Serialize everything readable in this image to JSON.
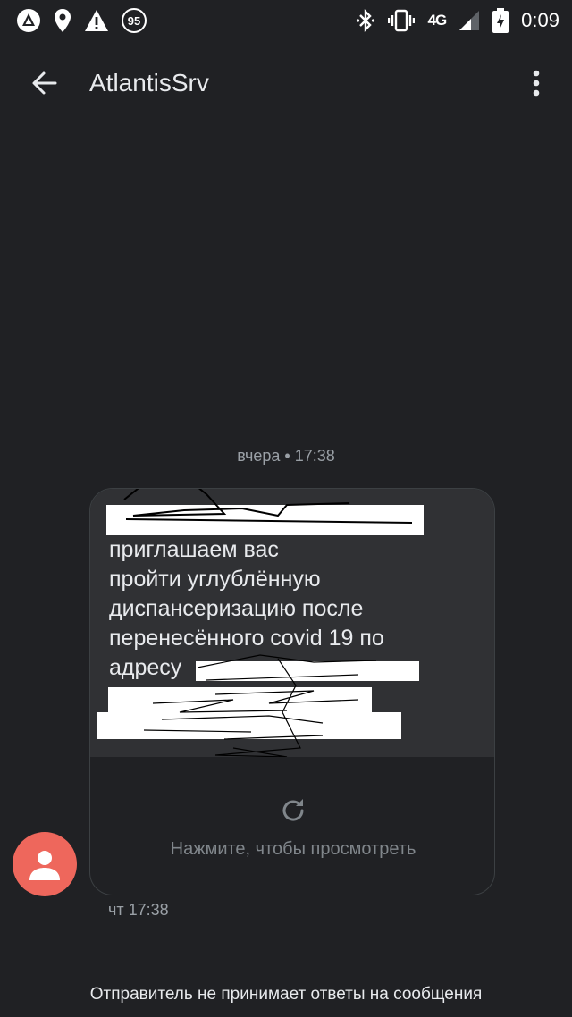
{
  "status_bar": {
    "battery_percent": "95",
    "network": "4G",
    "network_sub": "LTE",
    "time": "0:09",
    "icons": [
      "app-notification-icon",
      "location-icon",
      "warning-icon",
      "battery-saver-badge",
      "bluetooth-icon",
      "vibrate-icon",
      "network-4g-icon",
      "signal-icon",
      "battery-charging-icon"
    ]
  },
  "app_bar": {
    "back_icon": "arrow-back-icon",
    "title": "AtlantisSrv",
    "menu_icon": "more-vert-icon"
  },
  "conversation": {
    "date_separator": "вчера • 17:38",
    "message": {
      "text": "приглашаем вас\nпройти углублённую\nдиспансеризацию после\nперенесённого covid 19 по\nадресу",
      "mms_prompt": "Нажмите, чтобы просмотреть",
      "mms_icon": "refresh-icon",
      "timestamp": "чт 17:38"
    },
    "sender_avatar": "person-icon",
    "avatar_color": "#ee675c"
  },
  "footer": {
    "notice": "Отправитель не принимает ответы на сообщения"
  }
}
